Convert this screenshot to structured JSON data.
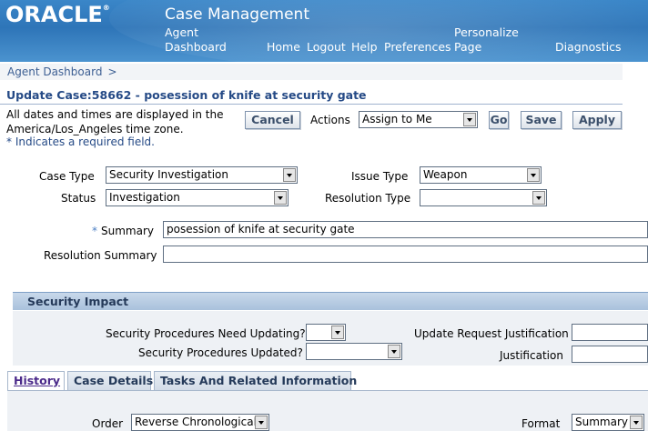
{
  "header": {
    "logo": "ORACLE",
    "app_title": "Case Management",
    "nav": {
      "agent_dashboard": "Agent\nDashboard",
      "home": "Home",
      "logout": "Logout",
      "help": "Help",
      "preferences": "Preferences",
      "personalize_page": "Personalize\nPage",
      "diagnostics": "Diagnostics"
    }
  },
  "breadcrumb": {
    "item": "Agent Dashboard",
    "separator": ">"
  },
  "page": {
    "title": "Update Case:58662 - posession of knife at security gate",
    "tz_note": "All dates and times are displayed in the America/Los_Angeles time zone.",
    "required_note": "* Indicates a required field."
  },
  "toolbar": {
    "cancel": "Cancel",
    "actions_label": "Actions",
    "actions_value": "Assign to Me",
    "go": "Go",
    "save": "Save",
    "apply": "Apply"
  },
  "form": {
    "case_type_label": "Case Type",
    "case_type_value": "Security Investigation",
    "issue_type_label": "Issue Type",
    "issue_type_value": "Weapon",
    "status_label": "Status",
    "status_value": "Investigation",
    "resolution_type_label": "Resolution Type",
    "resolution_type_value": "",
    "summary_required": "*",
    "summary_label": "Summary",
    "summary_value": "posession of knife at security gate",
    "resolution_summary_label": "Resolution Summary",
    "resolution_summary_value": ""
  },
  "security_impact": {
    "title": "Security Impact",
    "need_updating_label": "Security Procedures Need Updating?",
    "need_updating_value": "",
    "updated_label": "Security Procedures Updated?",
    "updated_value": "",
    "update_request_justification_label": "Update Request Justification",
    "justification_label": "Justification"
  },
  "tabs": [
    {
      "label": "History"
    },
    {
      "label": "Case Details"
    },
    {
      "label": "Tasks And Related Information"
    }
  ],
  "history": {
    "order_label": "Order",
    "order_value": "Reverse Chronological",
    "format_label": "Format",
    "format_value": "Summary"
  }
}
